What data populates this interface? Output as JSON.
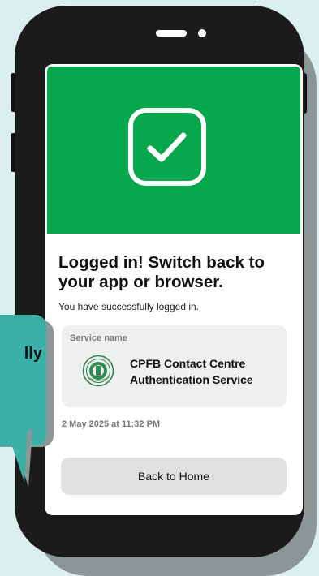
{
  "screen": {
    "title": "Logged in! Switch back to your app or browser.",
    "subtitle": "You have successfully logged in.",
    "card": {
      "label": "Service name",
      "service_name": "CPFB Contact Centre Authentication Service"
    },
    "datetime": "2 May 2025 at 11:32 PM",
    "button_label": "Back to Home"
  },
  "callout": {
    "text": "lly"
  },
  "icons": {
    "success": "check-square-icon",
    "seal": "cpf-seal-icon"
  },
  "colors": {
    "success_green": "#07a84d",
    "callout_teal": "#3bb0a6",
    "background": "#dcefef"
  }
}
